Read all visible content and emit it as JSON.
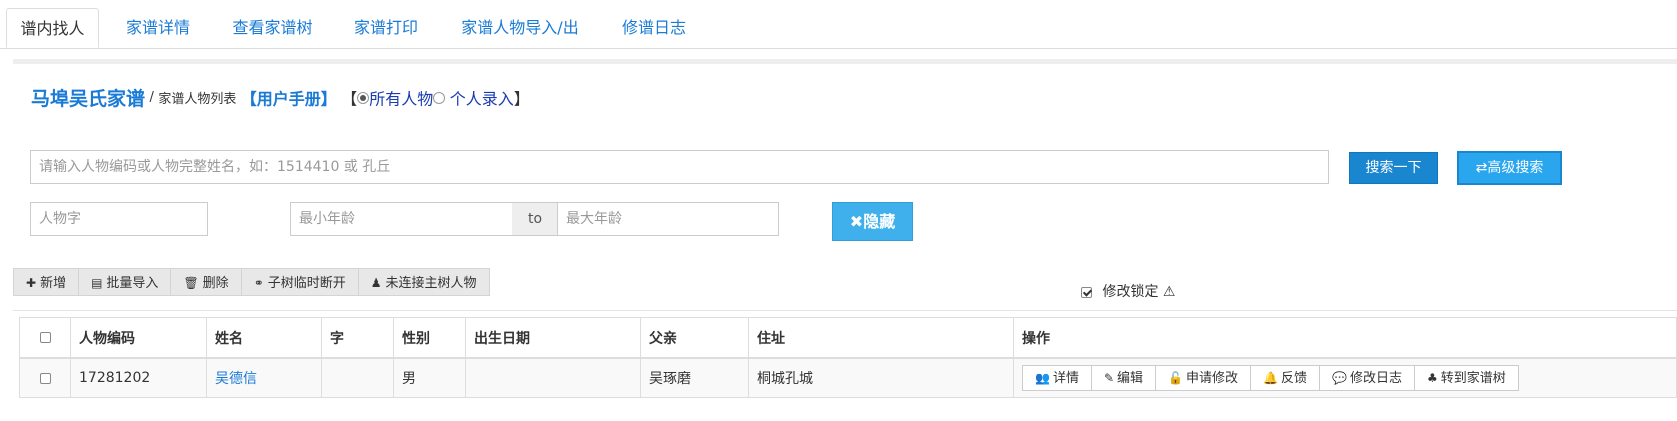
{
  "tabs": [
    {
      "label": "谱内找人",
      "active": true
    },
    {
      "label": "家谱详情"
    },
    {
      "label": "查看家谱树"
    },
    {
      "label": "家谱打印"
    },
    {
      "label": "家谱人物导入/出"
    },
    {
      "label": "修谱日志"
    }
  ],
  "title": {
    "family_name": "马埠吴氏家谱",
    "separator": "/",
    "subtitle": "家谱人物列表",
    "manual": "【用户手册】",
    "open_bracket": "【",
    "close_bracket": "】",
    "radio_all": "所有人物",
    "radio_personal": "个人录入"
  },
  "search": {
    "placeholder": "请输入人物编码或人物完整姓名，如：1514410 或 孔丘",
    "search_button": "搜索一下",
    "advanced_button": "⇄高级搜索"
  },
  "advanced": {
    "zi_placeholder": "人物字",
    "min_age_placeholder": "最小年龄",
    "to_label": "to",
    "max_age_placeholder": "最大年龄",
    "hide_button": "✖隐藏"
  },
  "toolbar": {
    "add": "新增",
    "batch_import": "批量导入",
    "delete": "删除",
    "subtree_disconnect": "子树临时断开",
    "unconnected": "未连接主树人物",
    "lock_label": "修改锁定"
  },
  "table": {
    "headers": {
      "code": "人物编码",
      "name": "姓名",
      "zi": "字",
      "gender": "性别",
      "birth": "出生日期",
      "father": "父亲",
      "address": "住址",
      "ops": "操作"
    },
    "rows": [
      {
        "code": "17281202",
        "name": "吴德信",
        "zi": "",
        "gender": "男",
        "birth": "",
        "father": "吴琢磨",
        "address": "桐城孔城"
      }
    ],
    "row_actions": {
      "detail": "详情",
      "edit": "编辑",
      "apply_edit": "申请修改",
      "feedback": "反馈",
      "edit_log": "修改日志",
      "to_tree": "转到家谱树"
    }
  },
  "colors": {
    "link": "#1a7bd6",
    "primary_button": "#1a86d0",
    "advanced_button": "#2aa6ef",
    "hide_button": "#3fb0ec"
  }
}
